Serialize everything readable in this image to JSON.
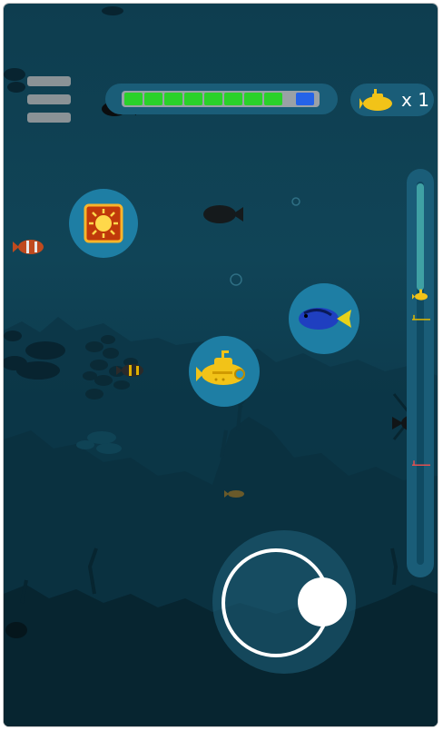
{
  "hud": {
    "health_fraction": 0.9,
    "lives_count": "x 1"
  },
  "depth_meter": {
    "player_level": 0.3,
    "markers": [
      {
        "name": "marker-yellow",
        "level": 0.36,
        "color": "#e0b800"
      },
      {
        "name": "marker-red",
        "level": 0.74,
        "color": "#e05050"
      }
    ]
  },
  "colors": {
    "water_top": "#0e3d4f",
    "water_bottom": "#082835",
    "hud_panel": "#1a5d78",
    "health_green": "#2ad12a",
    "health_end_blue": "#2563e8",
    "submarine_yellow": "#f2c318",
    "bubble_blue": "#1e7ea4",
    "joystick_white": "#ffffff"
  },
  "icons": {
    "menu": "hamburger-menu-icon",
    "lives": "submarine-icon",
    "powerup": "sun-powerup-icon",
    "target": "blue-tang-fish-icon",
    "player": "yellow-submarine-icon"
  }
}
